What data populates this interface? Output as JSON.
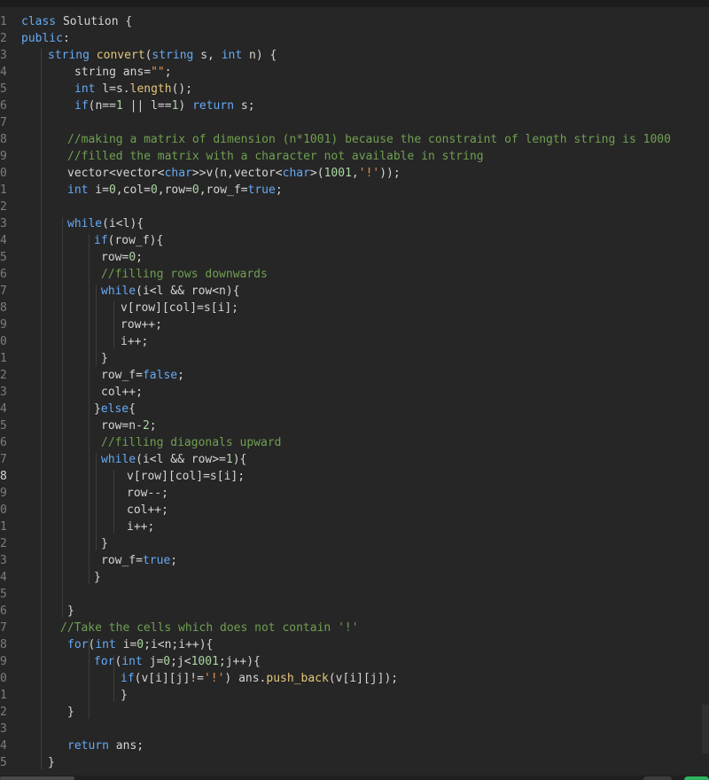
{
  "editor": {
    "colors": {
      "background": "#262626",
      "keyword": "#66a9f5",
      "function": "#e3c77a",
      "comment": "#6f9f52",
      "string": "#e4924f",
      "number": "#abd6a1",
      "text": "#d4d4d4"
    },
    "active_line_index": 27,
    "lines": [
      {
        "n": "1",
        "indent": 24,
        "toks": [
          [
            "kw",
            "class"
          ],
          [
            "id",
            " Solution {"
          ]
        ]
      },
      {
        "n": "2",
        "indent": 24,
        "toks": [
          [
            "kw",
            "public"
          ],
          [
            "id",
            ":"
          ]
        ]
      },
      {
        "n": "3",
        "indent": 54,
        "toks": [
          [
            "kw",
            "string"
          ],
          [
            "id",
            " "
          ],
          [
            "fn",
            "convert"
          ],
          [
            "id",
            "("
          ],
          [
            "kw",
            "string"
          ],
          [
            "id",
            " s, "
          ],
          [
            "kw",
            "int"
          ],
          [
            "id",
            " n) {"
          ]
        ]
      },
      {
        "n": "4",
        "indent": 84,
        "toks": [
          [
            "id",
            "string ans="
          ],
          [
            "st",
            "\"\""
          ],
          [
            "id",
            ";"
          ]
        ]
      },
      {
        "n": "5",
        "indent": 84,
        "toks": [
          [
            "kw",
            "int"
          ],
          [
            "id",
            " l=s."
          ],
          [
            "fn",
            "length"
          ],
          [
            "id",
            "();"
          ]
        ]
      },
      {
        "n": "6",
        "indent": 84,
        "toks": [
          [
            "kw",
            "if"
          ],
          [
            "id",
            "(n=="
          ],
          [
            "nu",
            "1"
          ],
          [
            "id",
            " || l=="
          ],
          [
            "nu",
            "1"
          ],
          [
            "id",
            ") "
          ],
          [
            "kw",
            "return"
          ],
          [
            "id",
            " s;"
          ]
        ]
      },
      {
        "n": "7",
        "indent": 76,
        "toks": []
      },
      {
        "n": "8",
        "indent": 76,
        "toks": [
          [
            "cm",
            "//making a matrix of dimension (n*1001) because the constraint of length string is 1000"
          ]
        ]
      },
      {
        "n": "9",
        "indent": 76,
        "toks": [
          [
            "cm",
            "//filled the matrix with a character not available in string"
          ]
        ]
      },
      {
        "n": "0",
        "indent": 76,
        "toks": [
          [
            "id",
            "vector<vector<"
          ],
          [
            "kw",
            "char"
          ],
          [
            "id",
            ">>v(n,vector<"
          ],
          [
            "kw",
            "char"
          ],
          [
            "id",
            ">("
          ],
          [
            "nu",
            "1001"
          ],
          [
            "id",
            ","
          ],
          [
            "st",
            "'!'"
          ],
          [
            "id",
            "));"
          ]
        ]
      },
      {
        "n": "1",
        "indent": 76,
        "toks": [
          [
            "kw",
            "int"
          ],
          [
            "id",
            " i="
          ],
          [
            "nu",
            "0"
          ],
          [
            "id",
            ",col="
          ],
          [
            "nu",
            "0"
          ],
          [
            "id",
            ",row="
          ],
          [
            "nu",
            "0"
          ],
          [
            "id",
            ",row_f="
          ],
          [
            "kw",
            "true"
          ],
          [
            "id",
            ";"
          ]
        ]
      },
      {
        "n": "2",
        "indent": 76,
        "toks": []
      },
      {
        "n": "3",
        "indent": 76,
        "toks": [
          [
            "kw",
            "while"
          ],
          [
            "id",
            "(i<l){"
          ]
        ]
      },
      {
        "n": "4",
        "indent": 106,
        "toks": [
          [
            "kw",
            "if"
          ],
          [
            "id",
            "(row_f){"
          ]
        ]
      },
      {
        "n": "5",
        "indent": 114,
        "toks": [
          [
            "id",
            "row="
          ],
          [
            "nu",
            "0"
          ],
          [
            "id",
            ";"
          ]
        ]
      },
      {
        "n": "6",
        "indent": 114,
        "toks": [
          [
            "cm",
            "//filling rows downwards"
          ]
        ]
      },
      {
        "n": "7",
        "indent": 114,
        "toks": [
          [
            "kw",
            "while"
          ],
          [
            "id",
            "(i<l && row<n){"
          ]
        ]
      },
      {
        "n": "8",
        "indent": 136,
        "toks": [
          [
            "id",
            "v[row][col]=s[i];"
          ]
        ]
      },
      {
        "n": "9",
        "indent": 136,
        "toks": [
          [
            "id",
            "row++;"
          ]
        ]
      },
      {
        "n": "0",
        "indent": 136,
        "toks": [
          [
            "id",
            "i++;"
          ]
        ]
      },
      {
        "n": "1",
        "indent": 114,
        "toks": [
          [
            "id",
            "}"
          ]
        ]
      },
      {
        "n": "2",
        "indent": 114,
        "toks": [
          [
            "id",
            "row_f="
          ],
          [
            "kw",
            "false"
          ],
          [
            "id",
            ";"
          ]
        ]
      },
      {
        "n": "3",
        "indent": 114,
        "toks": [
          [
            "id",
            "col++;"
          ]
        ]
      },
      {
        "n": "4",
        "indent": 106,
        "toks": [
          [
            "id",
            "}"
          ],
          [
            "kw",
            "else"
          ],
          [
            "id",
            "{"
          ]
        ]
      },
      {
        "n": "5",
        "indent": 114,
        "toks": [
          [
            "id",
            "row=n-"
          ],
          [
            "nu",
            "2"
          ],
          [
            "id",
            ";"
          ]
        ]
      },
      {
        "n": "6",
        "indent": 114,
        "toks": [
          [
            "cm",
            "//filling diagonals upward"
          ]
        ]
      },
      {
        "n": "7",
        "indent": 114,
        "toks": [
          [
            "kw",
            "while"
          ],
          [
            "id",
            "(i<l && row>="
          ],
          [
            "nu",
            "1"
          ],
          [
            "id",
            "){"
          ]
        ]
      },
      {
        "n": "8",
        "indent": 143,
        "toks": [
          [
            "id",
            "v[row][col]=s[i];"
          ]
        ]
      },
      {
        "n": "9",
        "indent": 143,
        "toks": [
          [
            "id",
            "row--;"
          ]
        ]
      },
      {
        "n": "0",
        "indent": 143,
        "toks": [
          [
            "id",
            "col++;"
          ]
        ]
      },
      {
        "n": "1",
        "indent": 143,
        "toks": [
          [
            "id",
            "i++;"
          ]
        ]
      },
      {
        "n": "2",
        "indent": 114,
        "toks": [
          [
            "id",
            "}"
          ]
        ]
      },
      {
        "n": "3",
        "indent": 114,
        "toks": [
          [
            "id",
            "row_f="
          ],
          [
            "kw",
            "true"
          ],
          [
            "id",
            ";"
          ]
        ]
      },
      {
        "n": "4",
        "indent": 106,
        "toks": [
          [
            "id",
            "}"
          ]
        ]
      },
      {
        "n": "5",
        "indent": 76,
        "toks": []
      },
      {
        "n": "6",
        "indent": 76,
        "toks": [
          [
            "id",
            "}"
          ]
        ]
      },
      {
        "n": "7",
        "indent": 68,
        "toks": [
          [
            "cm",
            "//Take the cells which does not contain '!'"
          ]
        ]
      },
      {
        "n": "8",
        "indent": 76,
        "toks": [
          [
            "kw",
            "for"
          ],
          [
            "id",
            "("
          ],
          [
            "kw",
            "int"
          ],
          [
            "id",
            " i="
          ],
          [
            "nu",
            "0"
          ],
          [
            "id",
            ";i<n;i++){"
          ]
        ]
      },
      {
        "n": "9",
        "indent": 106,
        "toks": [
          [
            "kw",
            "for"
          ],
          [
            "id",
            "("
          ],
          [
            "kw",
            "int"
          ],
          [
            "id",
            " j="
          ],
          [
            "nu",
            "0"
          ],
          [
            "id",
            ";j<"
          ],
          [
            "nu",
            "1001"
          ],
          [
            "id",
            ";j++){"
          ]
        ]
      },
      {
        "n": "0",
        "indent": 136,
        "toks": [
          [
            "kw",
            "if"
          ],
          [
            "id",
            "(v[i][j]!="
          ],
          [
            "st",
            "'!'"
          ],
          [
            "id",
            ") ans."
          ],
          [
            "fn",
            "push_back"
          ],
          [
            "id",
            "(v[i][j]);"
          ]
        ]
      },
      {
        "n": "1",
        "indent": 136,
        "toks": [
          [
            "id",
            "}"
          ]
        ]
      },
      {
        "n": "2",
        "indent": 76,
        "toks": [
          [
            "id",
            "}"
          ]
        ]
      },
      {
        "n": "3",
        "indent": 76,
        "toks": []
      },
      {
        "n": "4",
        "indent": 76,
        "toks": [
          [
            "kw",
            "return"
          ],
          [
            "id",
            " ans;"
          ]
        ]
      },
      {
        "n": "5",
        "indent": 54,
        "toks": [
          [
            "id",
            "}"
          ]
        ]
      }
    ]
  }
}
